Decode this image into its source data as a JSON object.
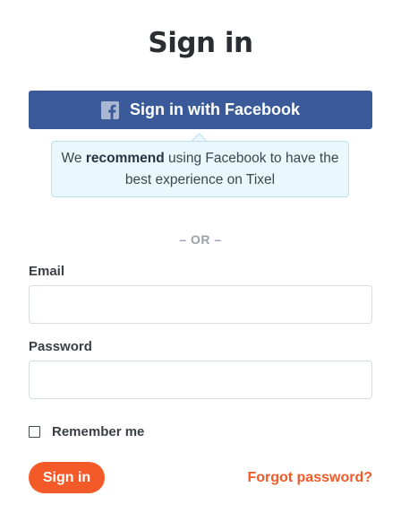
{
  "page": {
    "title": "Sign in"
  },
  "facebook_button": {
    "label": "Sign in with Facebook",
    "icon": "facebook-icon"
  },
  "tooltip": {
    "prefix": "We ",
    "emphasis": "recommend",
    "suffix": " using Facebook to have the best experience on Tixel"
  },
  "divider": {
    "text": "– OR –"
  },
  "form": {
    "email_label": "Email",
    "email_value": "",
    "password_label": "Password",
    "password_value": "",
    "remember_label": "Remember me",
    "remember_checked": false,
    "submit_label": "Sign in",
    "forgot_label": "Forgot password?"
  },
  "colors": {
    "facebook": "#3b5a9a",
    "accent": "#f35a27",
    "tooltip_bg": "#eaf7fd"
  }
}
